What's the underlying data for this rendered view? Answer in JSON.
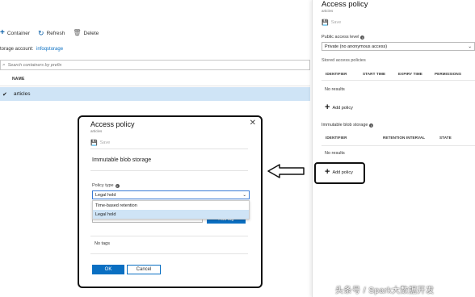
{
  "toolbar": {
    "container_label": "Container",
    "refresh_label": "Refresh",
    "delete_label": "Delete"
  },
  "storage_account": {
    "label": "torage account:",
    "value": "infoqstorage"
  },
  "search": {
    "placeholder": "Search containers by prefix"
  },
  "list": {
    "name_header": "NAME",
    "rows": [
      {
        "name": "articles",
        "selected": true
      }
    ]
  },
  "blade": {
    "title": "Access policy",
    "subtitle": "articles",
    "save_label": "Save",
    "public_access_label": "Public access level",
    "public_access_value": "Private (no anonymous access)",
    "stored_policies_label": "Stored access policies",
    "stored_columns": [
      "IDENTIFIER",
      "START TIME",
      "EXPIRY TIME",
      "PERMISSIONS"
    ],
    "stored_no_results": "No results",
    "add_policy_label": "Add policy",
    "immutable_label": "Immutable blob storage",
    "immutable_columns": [
      "IDENTIFIER",
      "RETENTION INTERVAL",
      "STATE"
    ],
    "immutable_no_results": "No results",
    "add_policy_label_2": "Add policy"
  },
  "dialog": {
    "title": "Access policy",
    "subtitle": "articles",
    "save_label": "Save",
    "section_title": "Immutable blob storage",
    "policy_type_label": "Policy type",
    "policy_type_value": "Legal hold",
    "options": [
      "Time-based retention",
      "Legal hold"
    ],
    "selected_option": "Legal hold",
    "add_tag_label": "Add tag",
    "no_tags": "No tags",
    "ok_label": "OK",
    "cancel_label": "Cancel"
  },
  "watermark": "头条号 / Spark大数据开发",
  "colors": {
    "accent": "#0a6fc2",
    "selection": "#cfe4f6"
  }
}
